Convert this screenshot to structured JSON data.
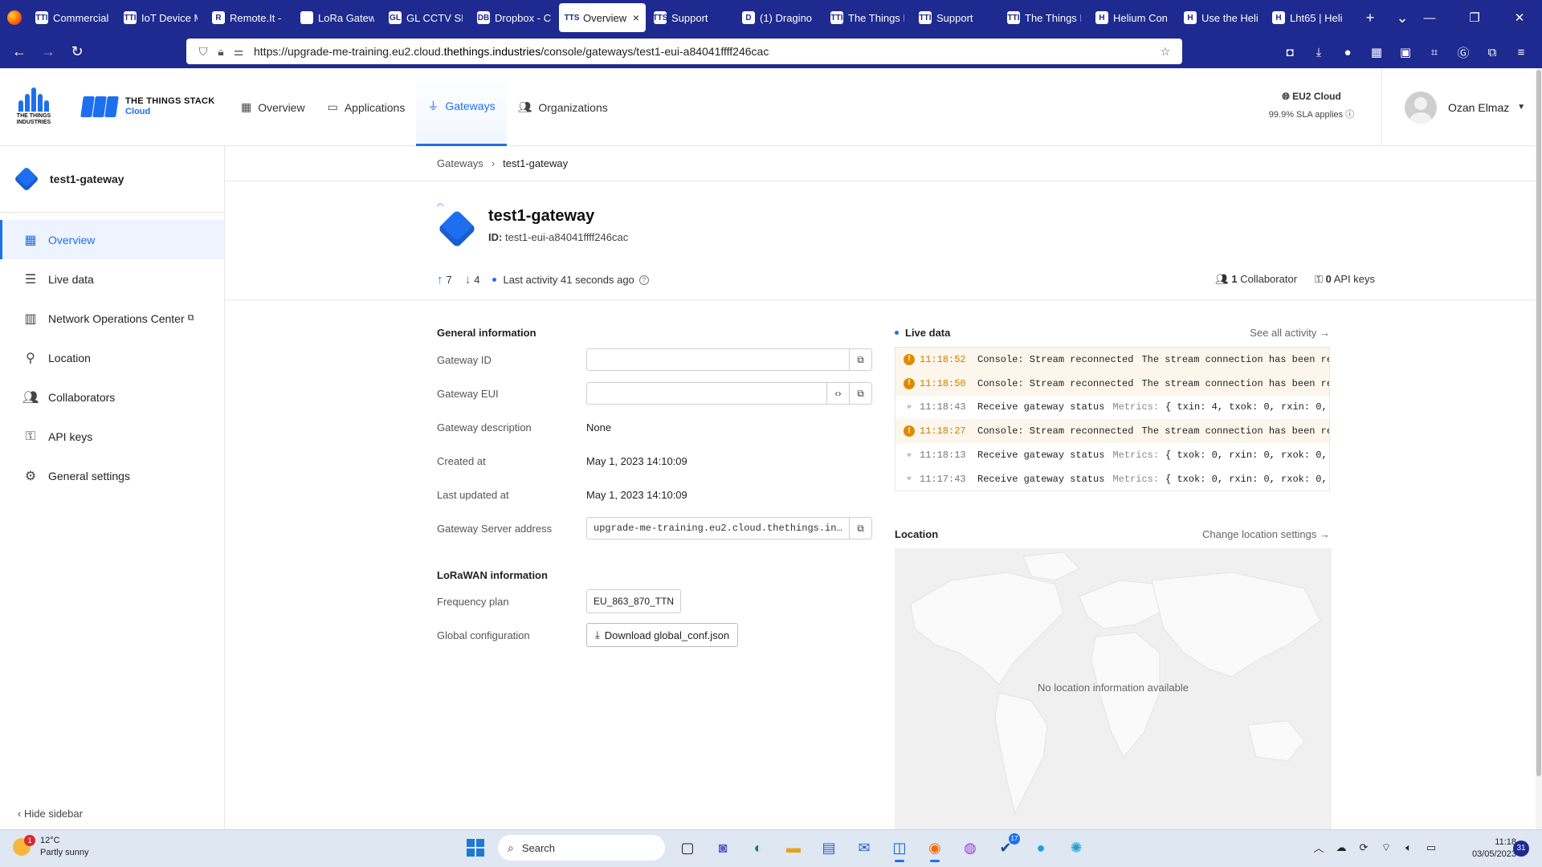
{
  "browser": {
    "tabs": [
      {
        "label": "Commercial",
        "fav": "TTI",
        "active": false
      },
      {
        "label": "IoT Device M",
        "fav": "TTI",
        "active": false
      },
      {
        "label": "Remote.It - ",
        "fav": "R",
        "active": false
      },
      {
        "label": "LoRa Gateway",
        "fav": "",
        "active": false
      },
      {
        "label": "GL CCTV SIM",
        "fav": "GL",
        "active": false
      },
      {
        "label": "Dropbox - C",
        "fav": "DB",
        "active": false
      },
      {
        "label": "Overview",
        "fav": "TTS",
        "active": true
      },
      {
        "label": "Support",
        "fav": "TTS",
        "active": false
      },
      {
        "label": "(1) Dragino",
        "fav": "D",
        "active": false
      },
      {
        "label": "The Things I",
        "fav": "TTI",
        "active": false
      },
      {
        "label": "Support",
        "fav": "TTI",
        "active": false
      },
      {
        "label": "The Things I",
        "fav": "TTI",
        "active": false
      },
      {
        "label": "Helium Con",
        "fav": "H",
        "active": false
      },
      {
        "label": "Use the Heli",
        "fav": "H",
        "active": false
      },
      {
        "label": "Lht65 | Heli",
        "fav": "H",
        "active": false
      }
    ],
    "url_prefix": "https://upgrade-me-training.eu2.cloud.",
    "url_domain": "thethings.industries",
    "url_path": "/console/gateways/test1-eui-a84041ffff246cac",
    "new_tab": "+",
    "tab_list": "⌄",
    "close_tab": "×"
  },
  "brand": {
    "tti_line1": "THE THINGS",
    "tti_line2": "INDUSTRIES",
    "tts_name": "THE THINGS STACK",
    "tts_edition": "Cloud",
    "accent": "#1e6ff0"
  },
  "nav": {
    "overview": "Overview",
    "applications": "Applications",
    "gateways": "Gateways",
    "organizations": "Organizations"
  },
  "cloud": {
    "region": "EU2 Cloud",
    "sla": "99.9% SLA applies"
  },
  "user": {
    "name": "Ozan Elmaz"
  },
  "sidebar": {
    "title": "test1-gateway",
    "items": [
      {
        "label": "Overview",
        "icon": "dashboard-icon"
      },
      {
        "label": "Live data",
        "icon": "live-data-icon"
      },
      {
        "label": "Network Operations Center",
        "icon": "bar-chart-icon"
      },
      {
        "label": "Location",
        "icon": "location-pin-icon"
      },
      {
        "label": "Collaborators",
        "icon": "people-icon"
      },
      {
        "label": "API keys",
        "icon": "key-icon"
      },
      {
        "label": "General settings",
        "icon": "gear-icon"
      }
    ],
    "hide": "Hide sidebar"
  },
  "breadcrumb": {
    "parent": "Gateways",
    "current": "test1-gateway"
  },
  "gateway": {
    "name": "test1-gateway",
    "id_label": "ID:",
    "id": "test1-eui-a84041ffff246cac",
    "uplinks": "7",
    "downlinks": "4",
    "last_activity": "Last activity 41 seconds ago",
    "collaborators_count": "1",
    "collaborators_label": "Collaborator",
    "api_keys_count": "0",
    "api_keys_label": "API keys"
  },
  "general": {
    "title": "General information",
    "gateway_id_label": "Gateway ID",
    "gateway_id_value": "",
    "gateway_eui_label": "Gateway EUI",
    "gateway_eui_value": "",
    "description_label": "Gateway description",
    "description_value": "None",
    "created_label": "Created at",
    "created_value": "May 1, 2023 14:10:09",
    "updated_label": "Last updated at",
    "updated_value": "May 1, 2023 14:10:09",
    "server_label": "Gateway Server address",
    "server_value": "upgrade-me-training.eu2.cloud.thethings.in…"
  },
  "lorawan": {
    "title": "LoRaWAN information",
    "freq_label": "Frequency plan",
    "freq_value": "EU_863_870_TTN",
    "global_label": "Global configuration",
    "download_label": "Download global_conf.json"
  },
  "live": {
    "title": "Live data",
    "see_all": "See all activity →",
    "events": [
      {
        "level": "warn",
        "time": "11:18:52",
        "type": "Console: Stream reconnected",
        "desc": "The stream connection has been re",
        "metrics_label": "",
        "metrics": ""
      },
      {
        "level": "warn",
        "time": "11:18:50",
        "type": "Console: Stream reconnected",
        "desc": "The stream connection has been re",
        "metrics_label": "",
        "metrics": ""
      },
      {
        "level": "info",
        "time": "11:18:43",
        "type": "Receive gateway status",
        "desc": "",
        "metrics_label": "Metrics:",
        "metrics": "{ txin: 4, txok: 0, rxin: 0,"
      },
      {
        "level": "warn",
        "time": "11:18:27",
        "type": "Console: Stream reconnected",
        "desc": "The stream connection has been re",
        "metrics_label": "",
        "metrics": ""
      },
      {
        "level": "info",
        "time": "11:18:13",
        "type": "Receive gateway status",
        "desc": "",
        "metrics_label": "Metrics:",
        "metrics": "{ txok: 0, rxin: 0, rxok: 0,"
      },
      {
        "level": "info",
        "time": "11:17:43",
        "type": "Receive gateway status",
        "desc": "",
        "metrics_label": "Metrics:",
        "metrics": "{ txok: 0, rxin: 0, rxok: 0,"
      }
    ]
  },
  "location": {
    "title": "Location",
    "change": "Change location settings →",
    "empty": "No location information available"
  },
  "taskbar": {
    "temp": "12°C",
    "weather": "Partly sunny",
    "weather_badge": "1",
    "search": "Search",
    "steam_badge": "17",
    "time": "11:18",
    "date": "03/05/2023",
    "notifications": "31"
  }
}
